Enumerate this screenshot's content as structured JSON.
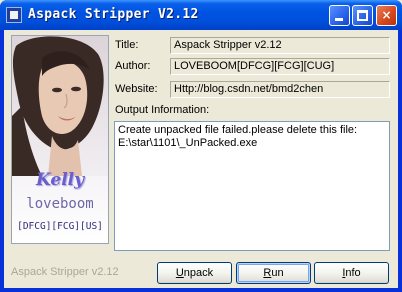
{
  "window": {
    "title": "Aspack Stripper V2.12",
    "controls": {
      "minimize": "minimize",
      "maximize": "maximize",
      "close": "×"
    }
  },
  "sidebar": {
    "name": "Kelly",
    "author_mark": "loveboom",
    "groups": "[DFCG][FCG][US]"
  },
  "info": {
    "title_label": "Title:",
    "title_value": "Aspack Stripper v2.12",
    "author_label": "Author:",
    "author_value": "LOVEBOOM[DFCG][FCG][CUG]",
    "website_label": "Website:",
    "website_value": "Http://blog.csdn.net/bmd2chen",
    "output_label": "Output Information:",
    "output_text": "Create unpacked file failed.please delete this file:\nE:\\star\\1101\\_UnPacked.exe"
  },
  "footer": {
    "version_text": "Aspack Stripper v2.12",
    "unpack": {
      "first": "U",
      "rest": "npack"
    },
    "run": {
      "first": "R",
      "rest": "un"
    },
    "info": {
      "first": "I",
      "rest": "nfo"
    }
  },
  "colors": {
    "titlebar": "#0054e3",
    "client": "#ece9d8",
    "accent_text": "#6a5fc8"
  }
}
